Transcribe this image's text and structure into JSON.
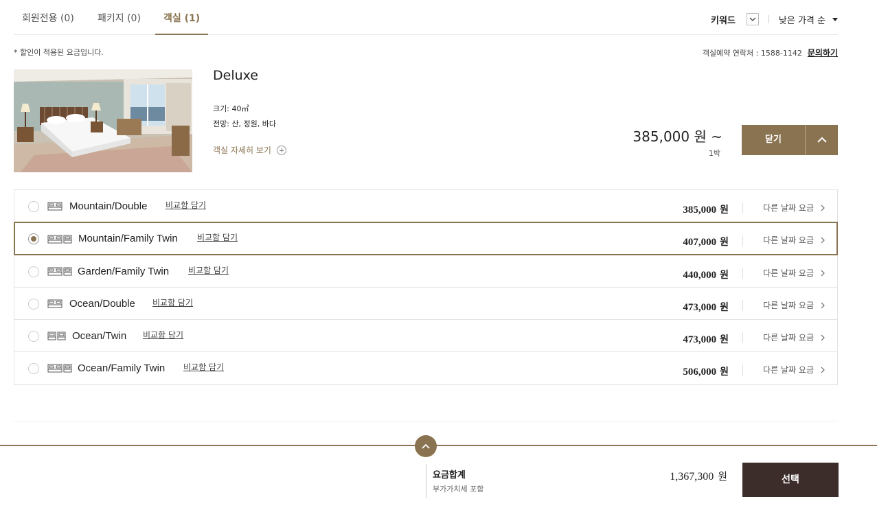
{
  "tabs": [
    {
      "label": "회원전용 (0)"
    },
    {
      "label": "패키지 (0)"
    },
    {
      "label": "객실 (1)"
    }
  ],
  "sort": {
    "keyword_label": "키워드",
    "order_label": "낮은 가격 순"
  },
  "notice": "* 할인이 적용된 요금입니다.",
  "contact": {
    "label": "객실예약 연락처 : 1588-1142",
    "link": "문의하기"
  },
  "room": {
    "name": "Deluxe",
    "size": "크기: 40㎡",
    "view": "전망: 산, 정원, 바다",
    "detail_link": "객실 자세히 보기",
    "price": "385,000 원 ~",
    "night": "1박",
    "close_label": "닫기"
  },
  "options": [
    {
      "name": "Mountain/Double",
      "compare": "비교함 담기",
      "price": "385,000",
      "currency": "원",
      "other": "다른 날짜 요금",
      "beds": "double",
      "selected": false
    },
    {
      "name": "Mountain/Family Twin",
      "compare": "비교함 담기",
      "price": "407,000",
      "currency": "원",
      "other": "다른 날짜 요금",
      "beds": "family",
      "selected": true
    },
    {
      "name": "Garden/Family Twin",
      "compare": "비교함 담기",
      "price": "440,000",
      "currency": "원",
      "other": "다른 날짜 요금",
      "beds": "family",
      "selected": false
    },
    {
      "name": "Ocean/Double",
      "compare": "비교함 담기",
      "price": "473,000",
      "currency": "원",
      "other": "다른 날짜 요금",
      "beds": "double",
      "selected": false
    },
    {
      "name": "Ocean/Twin",
      "compare": "비교함 담기",
      "price": "473,000",
      "currency": "원",
      "other": "다른 날짜 요금",
      "beds": "twin",
      "selected": false
    },
    {
      "name": "Ocean/Family Twin",
      "compare": "비교함 담기",
      "price": "506,000",
      "currency": "원",
      "other": "다른 날짜 요금",
      "beds": "family",
      "selected": false
    }
  ],
  "summary": {
    "label": "요금합계",
    "vat": "부가가치세 포함",
    "total": "1,367,300",
    "currency": "원",
    "select_label": "선택"
  },
  "colors": {
    "accent": "#8a7350",
    "dark_button": "#3c2d2b",
    "border": "#e3e3e3"
  }
}
